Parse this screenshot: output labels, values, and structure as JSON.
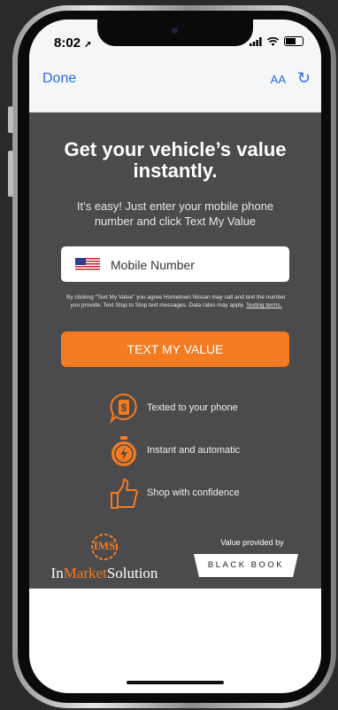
{
  "status_bar": {
    "time": "8:02",
    "location_arrow": "location-arrow-icon"
  },
  "nav": {
    "done_label": "Done",
    "text_size_label": "AA",
    "reload_icon": "reload-icon"
  },
  "main": {
    "headline": "Get your vehicle’s value instantly.",
    "subtext": "It’s easy! Just enter your mobile phone number and click Text My Value",
    "phone_input": {
      "placeholder": "Mobile Number",
      "country_flag": "us-flag-icon"
    },
    "disclaimer": "By clicking “Text My Value” you agree Hometown Nissan may call and text the number you provide. Text Stop to Stop text messages. Data rates may apply.",
    "terms_link": "Texting terms.",
    "cta_label": "TEXT MY VALUE",
    "features": [
      {
        "icon": "dollar-chat-icon",
        "label": "Texted to your phone"
      },
      {
        "icon": "stopwatch-icon",
        "label": "Instant and automatic"
      },
      {
        "icon": "thumbs-up-icon",
        "label": "Shop with confidence"
      }
    ]
  },
  "footer": {
    "ims_badge": "IMS",
    "ims_brand": {
      "part1": "In",
      "part2": "Market",
      "part3": "Solution"
    },
    "value_provided_by": "Value provided by",
    "blackbook": "BLACK BOOK"
  },
  "colors": {
    "accent": "#f47b20",
    "panel": "#4b4b4d",
    "link": "#2f6ad9"
  }
}
